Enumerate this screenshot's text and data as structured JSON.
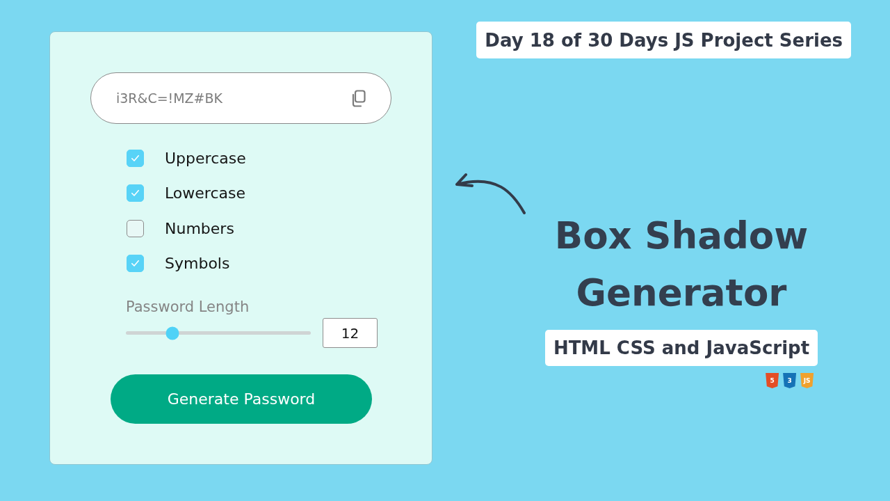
{
  "header_badge": {
    "text": "Day 18 of 30 Days JS Project Series"
  },
  "card": {
    "password_field": {
      "value": "i3R&C=!MZ#BK"
    },
    "options": [
      {
        "label": "Uppercase",
        "checked": true
      },
      {
        "label": "Lowercase",
        "checked": true
      },
      {
        "label": "Numbers",
        "checked": false
      },
      {
        "label": "Symbols",
        "checked": true
      }
    ],
    "length": {
      "label": "Password Length",
      "level": 0.25,
      "value": "12"
    },
    "generate_button": {
      "label": "Generate Password"
    }
  },
  "title": {
    "text": "Box Shadow Generator"
  },
  "subtitle_badge": {
    "text": "HTML CSS and JavaScript"
  },
  "tech_logos": [
    {
      "label": "5",
      "color": "#e44d26"
    },
    {
      "label": "3",
      "color": "#1572b6"
    },
    {
      "label": "JS",
      "color": "#f0a12e"
    }
  ]
}
